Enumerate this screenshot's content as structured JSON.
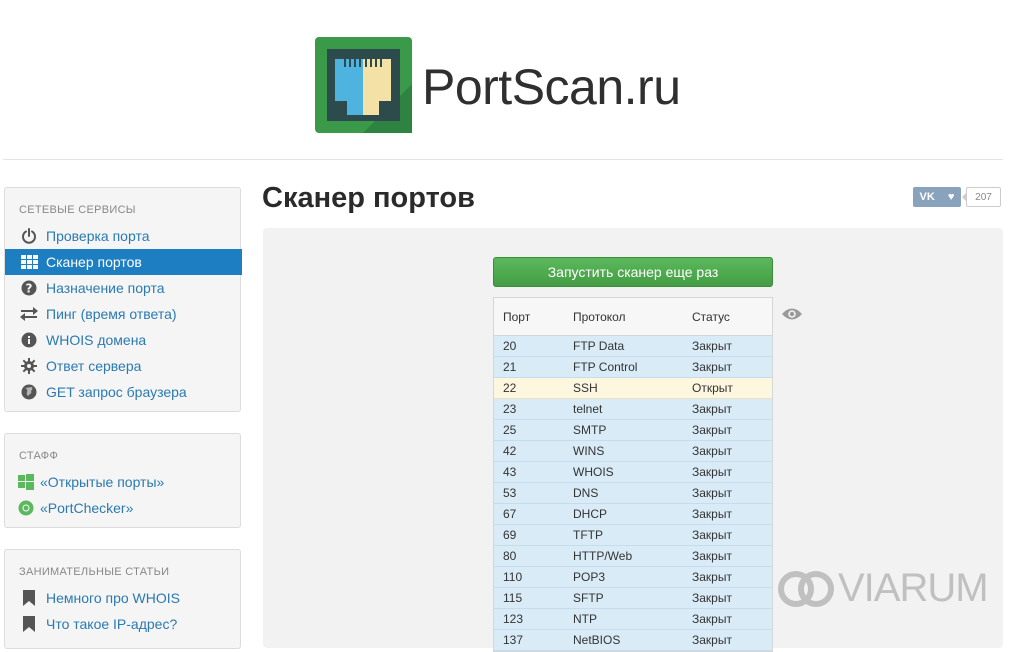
{
  "header": {
    "brand": "PortScan.ru",
    "logo_icon": "ethernet-port-icon",
    "colors": {
      "logo_green": "#3a9a4a",
      "logo_dark": "#2d4a4c",
      "logo_blue": "#4fb3e0",
      "logo_yellow": "#f3e1a6"
    }
  },
  "sidebar": {
    "network": {
      "title": "СЕТЕВЫЕ СЕРВИСЫ",
      "items": [
        {
          "label": "Проверка порта",
          "icon": "power-icon",
          "active": false
        },
        {
          "label": "Сканер портов",
          "icon": "grid-icon",
          "active": true
        },
        {
          "label": "Назначение порта",
          "icon": "question-icon",
          "active": false
        },
        {
          "label": "Пинг (время ответа)",
          "icon": "exchange-arrows-icon",
          "active": false
        },
        {
          "label": "WHOIS домена",
          "icon": "info-icon",
          "active": false
        },
        {
          "label": "Ответ сервера",
          "icon": "gear-icon",
          "active": false
        },
        {
          "label": "GET запрос браузера",
          "icon": "globe-icon",
          "active": false
        }
      ]
    },
    "staff": {
      "title": "СТАФФ",
      "items": [
        {
          "label": "«Открытые порты»",
          "icon": "windows-icon"
        },
        {
          "label": "«PortChecker»",
          "icon": "chrome-icon"
        }
      ]
    },
    "articles": {
      "title": "ЗАНИМАТЕЛЬНЫЕ СТАТЬИ",
      "items": [
        {
          "label": "Немного про WHOIS",
          "icon": "bookmark-icon"
        },
        {
          "label": "Что такое IP-адрес?",
          "icon": "bookmark-icon"
        }
      ]
    },
    "colors": {
      "active_bg": "#1d7fc1",
      "link": "#2a7ab0"
    }
  },
  "main": {
    "title": "Сканер портов",
    "share": {
      "network": "VK",
      "count": "207"
    },
    "run_button": "Запустить сканер еще раз",
    "table": {
      "headers": [
        "Порт",
        "Протокол",
        "Статус"
      ],
      "rows": [
        {
          "port": "20",
          "protocol": "FTP Data",
          "status": "Закрыт"
        },
        {
          "port": "21",
          "protocol": "FTP Control",
          "status": "Закрыт"
        },
        {
          "port": "22",
          "protocol": "SSH",
          "status": "Открыт"
        },
        {
          "port": "23",
          "protocol": "telnet",
          "status": "Закрыт"
        },
        {
          "port": "25",
          "protocol": "SMTP",
          "status": "Закрыт"
        },
        {
          "port": "42",
          "protocol": "WINS",
          "status": "Закрыт"
        },
        {
          "port": "43",
          "protocol": "WHOIS",
          "status": "Закрыт"
        },
        {
          "port": "53",
          "protocol": "DNS",
          "status": "Закрыт"
        },
        {
          "port": "67",
          "protocol": "DHCP",
          "status": "Закрыт"
        },
        {
          "port": "69",
          "protocol": "TFTP",
          "status": "Закрыт"
        },
        {
          "port": "80",
          "protocol": "HTTP/Web",
          "status": "Закрыт"
        },
        {
          "port": "110",
          "protocol": "POP3",
          "status": "Закрыт"
        },
        {
          "port": "115",
          "protocol": "SFTP",
          "status": "Закрыт"
        },
        {
          "port": "123",
          "protocol": "NTP",
          "status": "Закрыт"
        },
        {
          "port": "137",
          "protocol": "NetBIOS",
          "status": "Закрыт"
        }
      ],
      "colors": {
        "closed_row": "#d9ebf6",
        "open_row": "#fdf7e0"
      }
    }
  },
  "watermark": "VIARUM"
}
